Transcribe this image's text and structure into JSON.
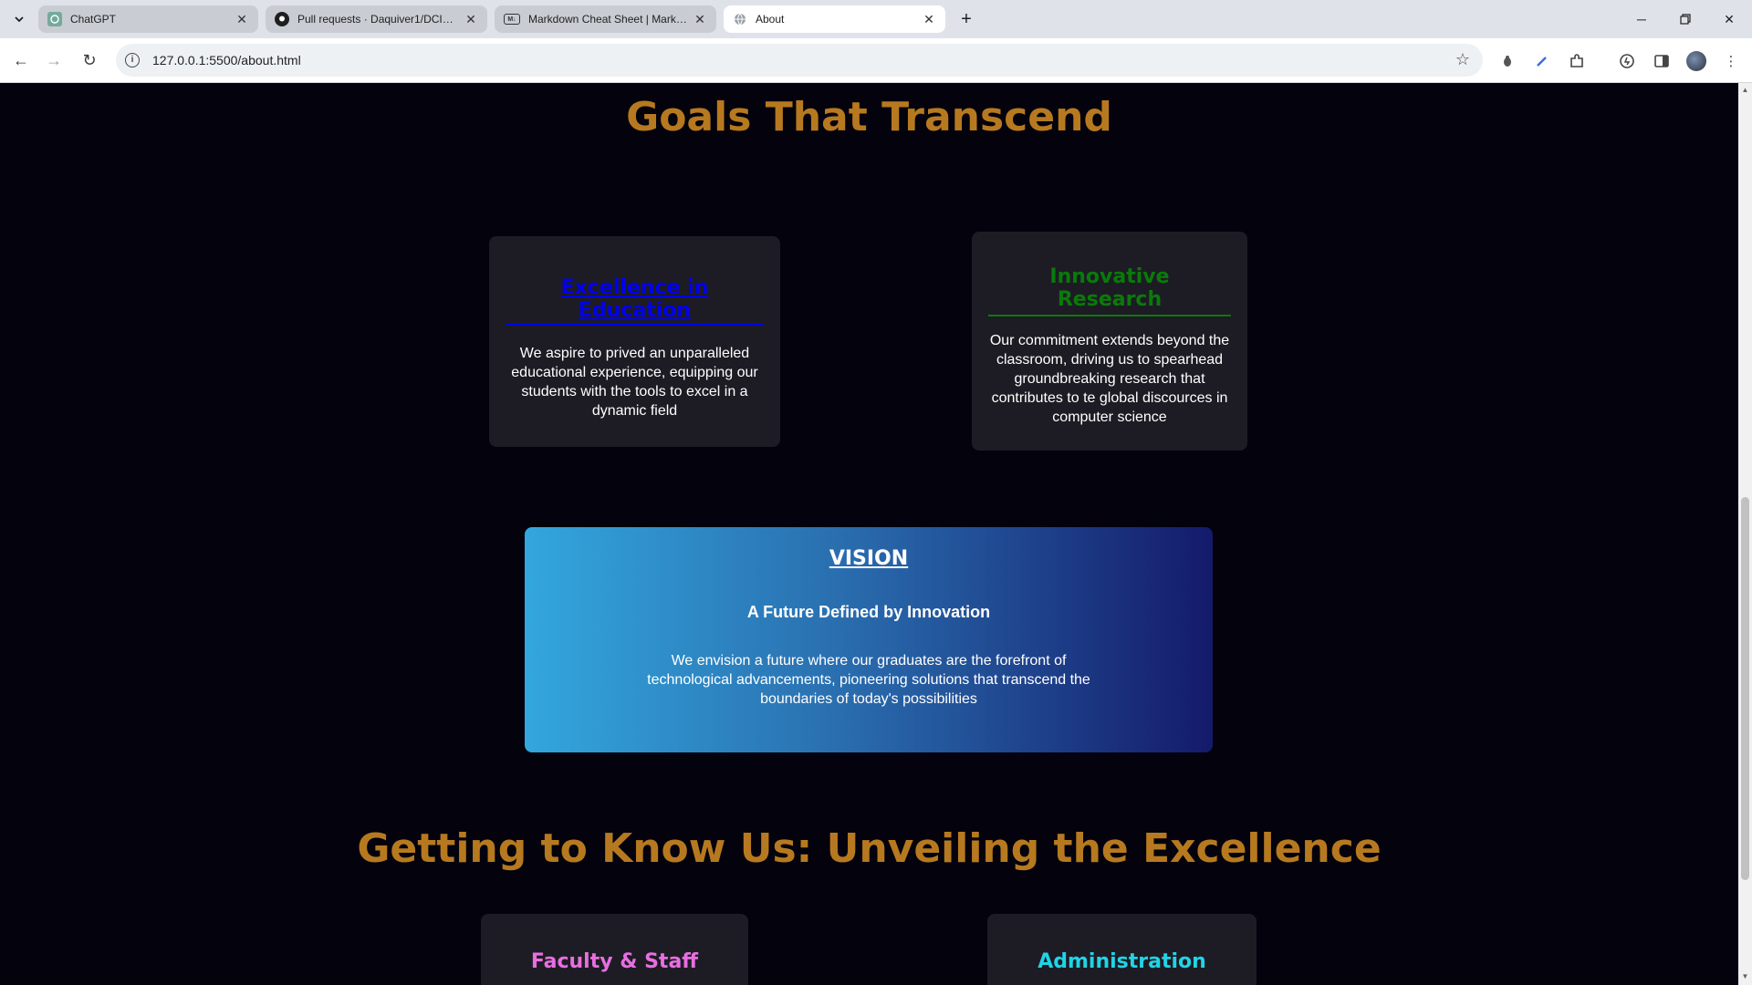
{
  "browser": {
    "tabs": [
      {
        "title": "ChatGPT",
        "icon": "chatgpt-icon"
      },
      {
        "title": "Pull requests · Daquiver1/DCIT_20",
        "icon": "github-icon"
      },
      {
        "title": "Markdown Cheat Sheet | Markdown",
        "icon": "markdown-icon"
      },
      {
        "title": "About",
        "icon": "globe-icon"
      }
    ],
    "url": "127.0.0.1:5500/about.html"
  },
  "page": {
    "goals_heading": "Goals That Transcend",
    "goal_cards": [
      {
        "title": "Excellence in Education",
        "title_color": "#0000ee",
        "text": "We aspire to prived an unparalleled educational experience, equipping our students with the tools to excel in a dynamic field"
      },
      {
        "title": "Innovative Research",
        "title_color": "#0a7a0a",
        "text": "Our commitment extends beyond the classroom, driving us to spearhead groundbreaking research that contributes to te global discources in computer science"
      }
    ],
    "vision": {
      "label": "VISION",
      "subtitle": "A Future Defined by Innovation",
      "text": "We envision a future where our graduates are the forefront of technological advancements, pioneering solutions that transcend the boundaries of today's possibilities"
    },
    "know_us_heading": "Getting to Know Us: Unveiling the Excellence",
    "know_cards": [
      {
        "title": "Faculty & Staff",
        "title_color": "#e86ee0"
      },
      {
        "title": "Administration",
        "title_color": "#22d3e6"
      }
    ]
  }
}
